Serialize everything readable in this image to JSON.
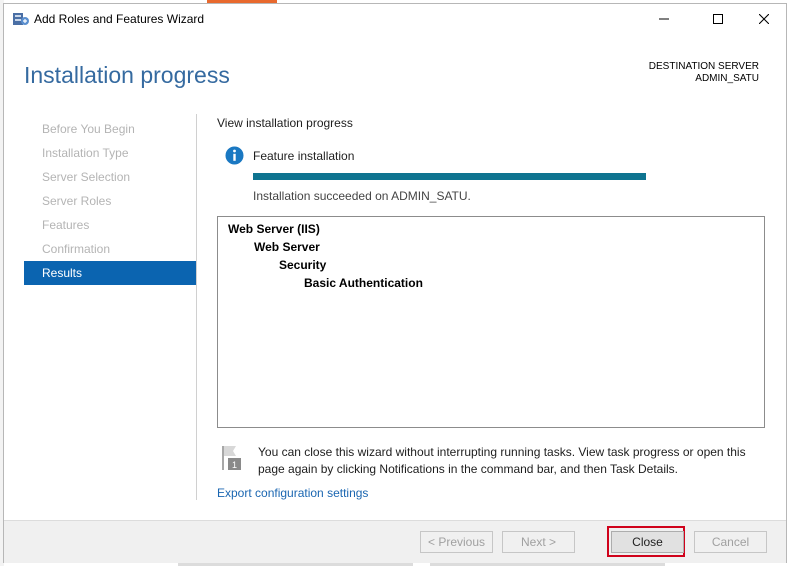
{
  "window": {
    "title": "Add Roles and Features Wizard"
  },
  "page": {
    "title": "Installation progress"
  },
  "destination": {
    "label": "DESTINATION SERVER",
    "server": "ADMIN_SATU"
  },
  "nav": {
    "items": [
      {
        "label": "Before You Begin",
        "state": "disabled"
      },
      {
        "label": "Installation Type",
        "state": "disabled"
      },
      {
        "label": "Server Selection",
        "state": "disabled"
      },
      {
        "label": "Server Roles",
        "state": "disabled"
      },
      {
        "label": "Features",
        "state": "disabled"
      },
      {
        "label": "Confirmation",
        "state": "disabled"
      },
      {
        "label": "Results",
        "state": "active"
      }
    ]
  },
  "content": {
    "section_title": "View installation progress",
    "feature_label": "Feature installation",
    "progress": 1.0,
    "status": "Installation succeeded on ADMIN_SATU.",
    "features": [
      {
        "label": "Web Server (IIS)",
        "level": 0
      },
      {
        "label": "Web Server",
        "level": 1
      },
      {
        "label": "Security",
        "level": 2
      },
      {
        "label": "Basic Authentication",
        "level": 3
      }
    ],
    "note": "You can close this wizard without interrupting running tasks. View task progress or open this page again by clicking Notifications in the command bar, and then Task Details.",
    "note_badge": "1",
    "export_link": "Export configuration settings"
  },
  "buttons": {
    "previous": "< Previous",
    "next": "Next >",
    "close": "Close",
    "cancel": "Cancel"
  },
  "colors": {
    "accent": "#0b64b0",
    "title": "#356aa0",
    "progress": "#0e7490",
    "highlight": "#d0021b"
  }
}
